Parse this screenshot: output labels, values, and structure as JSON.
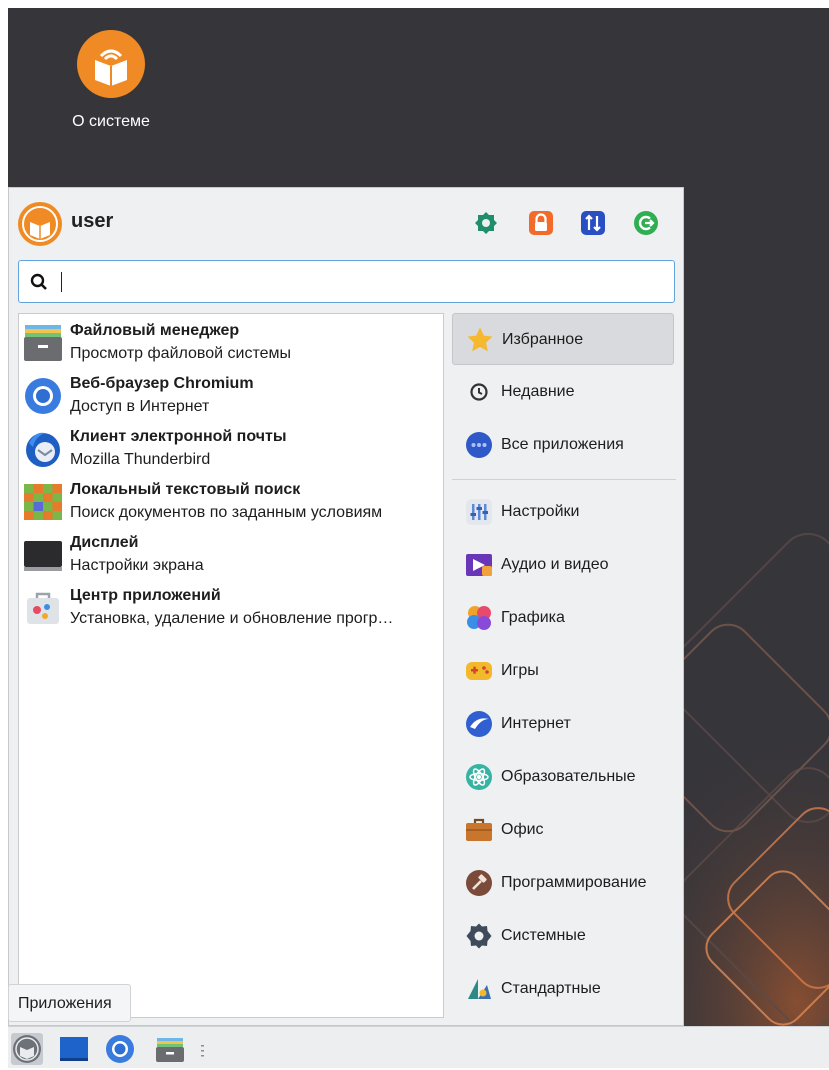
{
  "desktop": {
    "icon_label": "О системе",
    "icon_name": "about-system-icon"
  },
  "menu": {
    "username": "user",
    "header_buttons": [
      {
        "name": "settings-icon",
        "color": "#1f8f6b"
      },
      {
        "name": "lock-icon",
        "color": "#f26b2a"
      },
      {
        "name": "switch-user-icon",
        "color": "#2a4fc2"
      },
      {
        "name": "logout-icon",
        "color": "#2fae52"
      }
    ],
    "search": {
      "value": "",
      "placeholder": ""
    },
    "apps": [
      {
        "title": "Файловый менеджер",
        "desc": "Просмотр файловой системы",
        "icon": "file-manager-icon"
      },
      {
        "title": "Веб-браузер Chromium",
        "desc": "Доступ в Интернет",
        "icon": "chromium-icon"
      },
      {
        "title": "Клиент электронной почты",
        "desc": "Mozilla Thunderbird",
        "icon": "thunderbird-icon"
      },
      {
        "title": "Локальный текстовый поиск",
        "desc": "Поиск документов по заданным условиям",
        "icon": "text-search-icon"
      },
      {
        "title": "Дисплей",
        "desc": "Настройки экрана",
        "icon": "display-icon"
      },
      {
        "title": "Центр приложений",
        "desc": "Установка, удаление и обновление прогр…",
        "icon": "app-center-icon"
      }
    ],
    "categories_top": [
      {
        "label": "Избранное",
        "icon": "star-icon",
        "active": true
      },
      {
        "label": "Недавние",
        "icon": "clock-icon"
      },
      {
        "label": "Все приложения",
        "icon": "all-apps-icon"
      }
    ],
    "categories": [
      {
        "label": "Настройки",
        "icon": "settings-category-icon"
      },
      {
        "label": "Аудио и видео",
        "icon": "multimedia-icon"
      },
      {
        "label": "Графика",
        "icon": "graphics-icon"
      },
      {
        "label": "Игры",
        "icon": "games-icon"
      },
      {
        "label": "Интернет",
        "icon": "internet-icon"
      },
      {
        "label": "Образовательные",
        "icon": "education-icon"
      },
      {
        "label": "Офис",
        "icon": "office-icon"
      },
      {
        "label": "Программирование",
        "icon": "programming-icon"
      },
      {
        "label": "Системные",
        "icon": "system-icon"
      },
      {
        "label": "Стандартные",
        "icon": "accessories-icon"
      }
    ]
  },
  "tooltip": "Приложения",
  "taskbar": {
    "items": [
      "applications-menu-icon",
      "show-desktop-icon",
      "chromium-icon",
      "file-manager-icon"
    ]
  },
  "colors": {
    "desktop_bg": "#36353a",
    "menu_bg": "#eef0f2",
    "search_border": "#63a3de",
    "accent_orange": "#f08a24"
  }
}
